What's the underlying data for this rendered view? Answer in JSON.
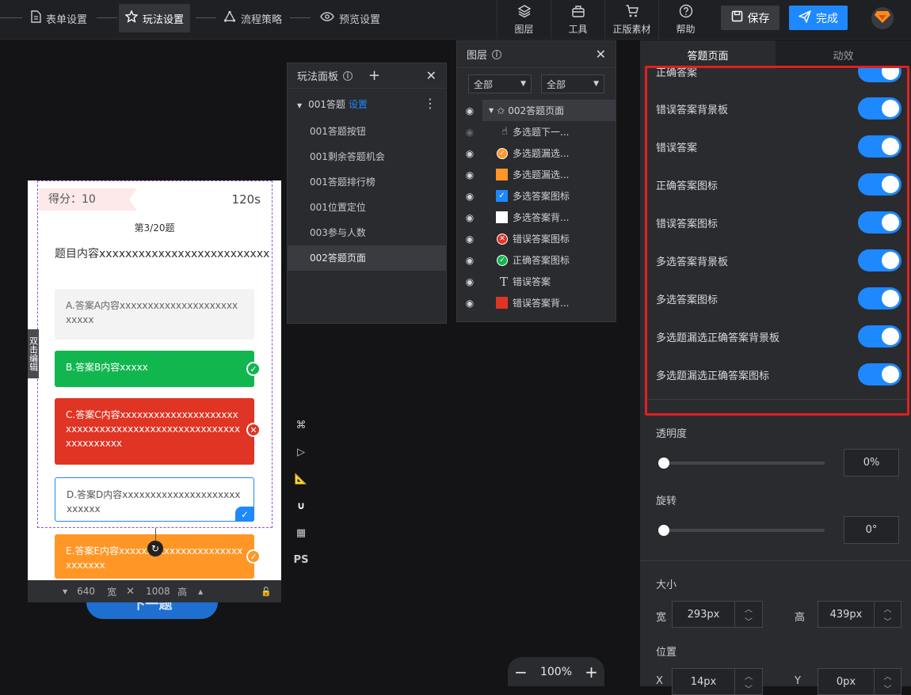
{
  "steps": [
    {
      "label": "表单设置",
      "icon": "document-icon"
    },
    {
      "label": "玩法设置",
      "icon": "star-icon"
    },
    {
      "label": "流程策略",
      "icon": "flow-icon"
    },
    {
      "label": "预览设置",
      "icon": "eye-icon"
    }
  ],
  "tools": [
    {
      "label": "图层",
      "icon": "layers-icon"
    },
    {
      "label": "工具",
      "icon": "toolbox-icon"
    },
    {
      "label": "正版素材",
      "icon": "cart-icon"
    },
    {
      "label": "帮助",
      "icon": "help-icon"
    }
  ],
  "actions": {
    "save": "保存",
    "done": "完成"
  },
  "play_panel": {
    "title": "玩法面板",
    "group": "001答题",
    "group_link": "设置",
    "items": [
      "001答题按钮",
      "001剩余答题机会",
      "001答题排行榜",
      "001位置定位",
      "003参与人数",
      "002答题页面"
    ]
  },
  "layer_panel": {
    "title": "图层",
    "filter1": "全部",
    "filter2": "全部",
    "root": "002答题页面",
    "items": [
      {
        "label": "多选题下一...",
        "icon": "pointer-icon"
      },
      {
        "label": "多选题漏选...",
        "icon": "orange-check-icon"
      },
      {
        "label": "多选题漏选...",
        "icon": "orange-square-icon"
      },
      {
        "label": "多选答案图标",
        "icon": "blue-check-icon"
      },
      {
        "label": "多选答案背...",
        "icon": "white-square-icon"
      },
      {
        "label": "错误答案图标",
        "icon": "red-x-icon"
      },
      {
        "label": "正确答案图标",
        "icon": "green-check-icon"
      },
      {
        "label": "错误答案",
        "icon": "text-icon"
      },
      {
        "label": "错误答案背...",
        "icon": "red-square-icon"
      }
    ]
  },
  "phone": {
    "score": "得分：10",
    "timer": "120s",
    "progress": "第3/20题",
    "question": "题目内容xxxxxxxxxxxxxxxxxxxxxxxxxx",
    "answers": [
      "A.答案A内容xxxxxxxxxxxxxxxxxxxxxxxxxx",
      "B.答案B内容xxxxx",
      "C.答案C内容xxxxxxxxxxxxxxxxxxxxxxxxxxxxxxxxxxxxxxxxxxxxxxxxxxxxxxxxxxxxxx",
      "D.答案D内容xxxxxxxxxxxxxxxxxxxxxxxxxxx",
      "E.答案E内容xxxxxxxxxxxxxxxxxxxxxxxxxxxxx"
    ],
    "edit_hint": "双击编辑",
    "next_button": "下一题",
    "width_value": "640",
    "width_label": "宽",
    "height_value": "1008",
    "height_label": "高"
  },
  "side_tools": [
    "command-icon",
    "play-icon",
    "ruler-icon",
    "magnet-icon",
    "grid-icon"
  ],
  "side_tool_ps": "PS",
  "zoom": "100%",
  "right_panel": {
    "tabs": [
      "答题页面",
      "动效"
    ],
    "partial_label": "正确答案",
    "toggles": [
      "错误答案背景板",
      "错误答案",
      "正确答案图标",
      "错误答案图标",
      "多选答案背景板",
      "多选答案图标",
      "多选题漏选正确答案背景板",
      "多选题漏选正确答案图标"
    ],
    "opacity_label": "透明度",
    "opacity_value": "0%",
    "rotate_label": "旋转",
    "rotate_value": "0°",
    "size_label": "大小",
    "width_label": "宽",
    "width_value": "293px",
    "height_label": "高",
    "height_value": "439px",
    "position_label": "位置",
    "x_label": "X",
    "x_value": "14px",
    "y_label": "Y",
    "y_value": "0px"
  },
  "colors": {
    "accent": "#1e88ff",
    "green": "#12b64f",
    "red": "#e03424",
    "orange": "#ff9626",
    "highlight": "#e02020"
  }
}
